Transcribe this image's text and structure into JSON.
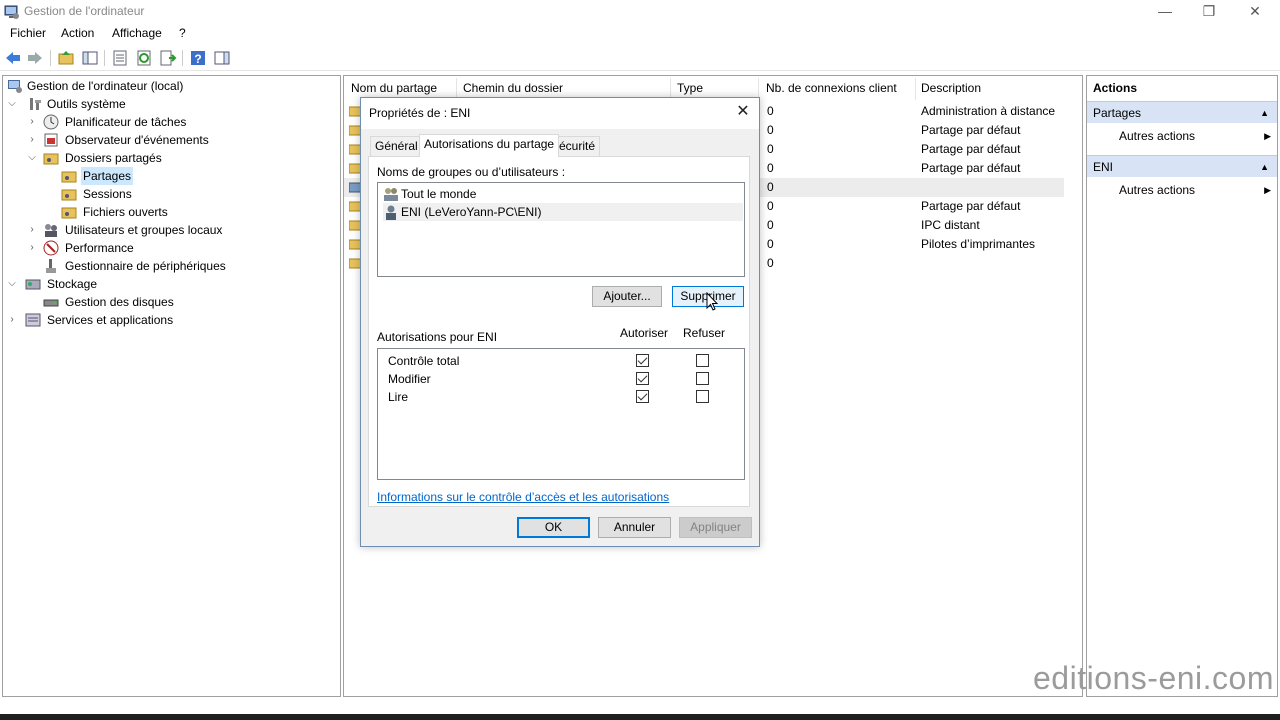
{
  "window": {
    "title": "Gestion de l'ordinateur",
    "controls": {
      "minimize": "—",
      "restore": "❐",
      "close": "✕"
    }
  },
  "menu": [
    "Fichier",
    "Action",
    "Affichage",
    "?"
  ],
  "tree": {
    "root": "Gestion de l'ordinateur (local)",
    "outils": "Outils système",
    "planificateur": "Planificateur de tâches",
    "observateur": "Observateur d'événements",
    "dossiers": "Dossiers partagés",
    "partages": "Partages",
    "sessions": "Sessions",
    "fichiers": "Fichiers ouverts",
    "utilisateurs": "Utilisateurs et groupes locaux",
    "performance": "Performance",
    "gestionnaire": "Gestionnaire de périphériques",
    "stockage": "Stockage",
    "disques": "Gestion des disques",
    "services": "Services et applications"
  },
  "list": {
    "columns": [
      "Nom du partage",
      "Chemin du dossier",
      "Type",
      "Nb. de connexions client",
      "Description"
    ],
    "rows": [
      {
        "connections": "0",
        "description": "Administration à distance"
      },
      {
        "connections": "0",
        "description": "Partage par défaut"
      },
      {
        "connections": "0",
        "description": "Partage par défaut"
      },
      {
        "connections": "0",
        "description": "Partage par défaut"
      },
      {
        "connections": "0",
        "description": ""
      },
      {
        "connections": "0",
        "description": "Partage par défaut"
      },
      {
        "connections": "0",
        "description": "IPC distant"
      },
      {
        "connections": "0",
        "description": "Pilotes d’imprimantes"
      },
      {
        "connections": "0",
        "description": ""
      }
    ]
  },
  "actions": {
    "header": "Actions",
    "section1": "Partages",
    "section1_item": "Autres actions",
    "section2": "ENI",
    "section2_item": "Autres actions"
  },
  "dialog": {
    "title": "Propriétés de : ENI",
    "tabs": [
      "Général",
      "Autorisations du partage",
      "Sécurité"
    ],
    "groups_label": "Noms de groupes ou d’utilisateurs :",
    "users": [
      "Tout le monde",
      "ENI (LeVeroYann-PC\\ENI)"
    ],
    "add_button": "Ajouter...",
    "remove_button": "Supprimer",
    "perm_label": "Autorisations pour ENI",
    "allow_header": "Autoriser",
    "deny_header": "Refuser",
    "permissions": [
      {
        "name": "Contrôle total",
        "allow": true,
        "deny": false
      },
      {
        "name": "Modifier",
        "allow": true,
        "deny": false
      },
      {
        "name": "Lire",
        "allow": true,
        "deny": false
      }
    ],
    "info_link": "Informations sur le contrôle d’accès et les autorisations",
    "ok": "OK",
    "cancel": "Annuler",
    "apply": "Appliquer"
  },
  "watermark": "editions-eni.com"
}
